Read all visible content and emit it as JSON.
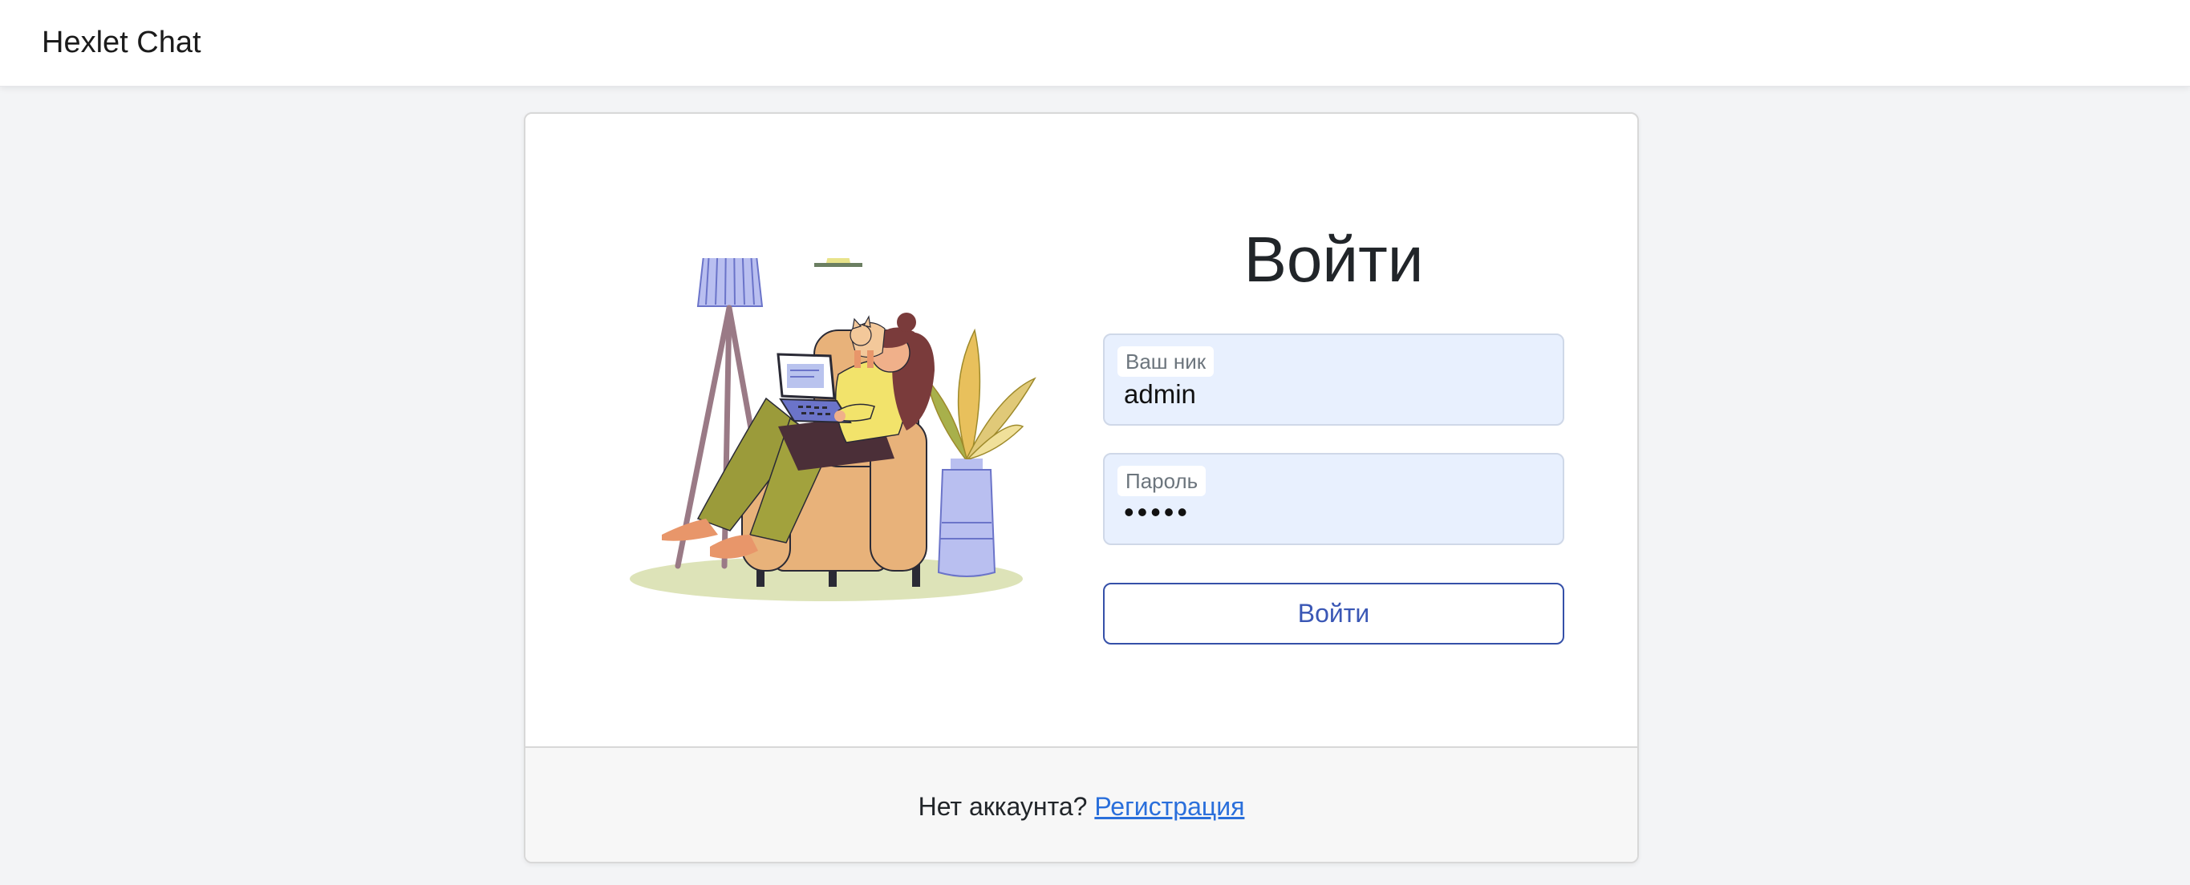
{
  "navbar": {
    "brand": "Hexlet Chat"
  },
  "login": {
    "title": "Войти",
    "username": {
      "label": "Ваш ник",
      "value": "admin"
    },
    "password": {
      "label": "Пароль",
      "value": "•••••"
    },
    "submit_label": "Войти"
  },
  "footer": {
    "prompt": "Нет аккаунта?",
    "link_label": "Регистрация"
  },
  "colors": {
    "accent": "#3a57b5",
    "link": "#2a6fdb",
    "input_bg": "#e8f0fe"
  }
}
